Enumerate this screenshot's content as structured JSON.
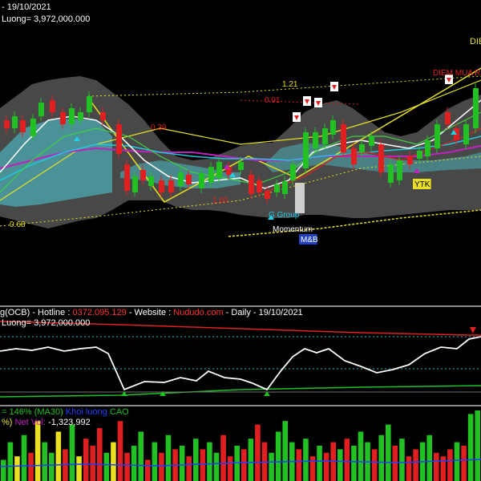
{
  "main_panel": {
    "header_line1": "- 19/10/2021",
    "header_line2": "Luong= 3,972,000.000",
    "fib_labels": [
      "1.21",
      "0.91",
      "0.39",
      "1.00",
      "0.68"
    ],
    "annotations": {
      "die": "DIE",
      "diem_mua_ro": "DIEM MUA RO",
      "ytk": "YTK",
      "momentum": "Momentum",
      "mb": "M&B",
      "group": "G Group"
    },
    "colors": {
      "up": "#22c022",
      "down": "#e02020",
      "bollinger": "#9a9a9a",
      "cloud": "#4a9aa0",
      "ma_yellow": "#e8e020",
      "ma_magenta": "#c020c0",
      "ma_white": "#ffffff",
      "ma_cyan": "#20c8e0"
    }
  },
  "osc_panel": {
    "title_prefix": "g(OCB) - Hotline : ",
    "hotline": "0372.095.129",
    "website_label": " - Website : ",
    "website": "Nududo.com",
    "suffix": " - Daily - 19/10/2021",
    "line2": "Luong= 3,972,000.000"
  },
  "vol_panel": {
    "line1_a": "= 146%",
    "line1_b": "(MA30)",
    "line1_c": "Khoi luong",
    "line1_d": "CAO",
    "line2_a": "%)",
    "line2_b": "Net Vol:",
    "line2_c": "-1,323,992",
    "volumes": [
      0.3,
      0.55,
      0.35,
      0.65,
      0.4,
      0.85,
      0.55,
      0.4,
      0.7,
      0.45,
      0.8,
      0.35,
      0.6,
      0.5,
      0.75,
      0.4,
      0.55,
      0.85,
      0.4,
      0.5,
      0.7,
      0.3,
      0.55,
      0.4,
      0.65,
      0.45,
      0.5,
      0.35,
      0.6,
      0.45,
      0.55,
      0.4,
      0.65,
      0.35,
      0.5,
      0.45,
      0.6,
      0.8,
      0.55,
      0.4,
      0.7,
      0.85,
      0.55,
      0.45,
      0.6,
      0.35,
      0.5,
      0.4,
      0.55,
      0.45,
      0.6,
      0.5,
      0.7,
      0.55,
      0.45,
      0.65,
      0.8,
      0.5,
      0.6,
      0.35,
      0.45,
      0.55,
      0.65,
      0.4,
      0.35,
      0.45,
      0.55,
      0.5,
      0.95,
      1.0
    ]
  }
}
